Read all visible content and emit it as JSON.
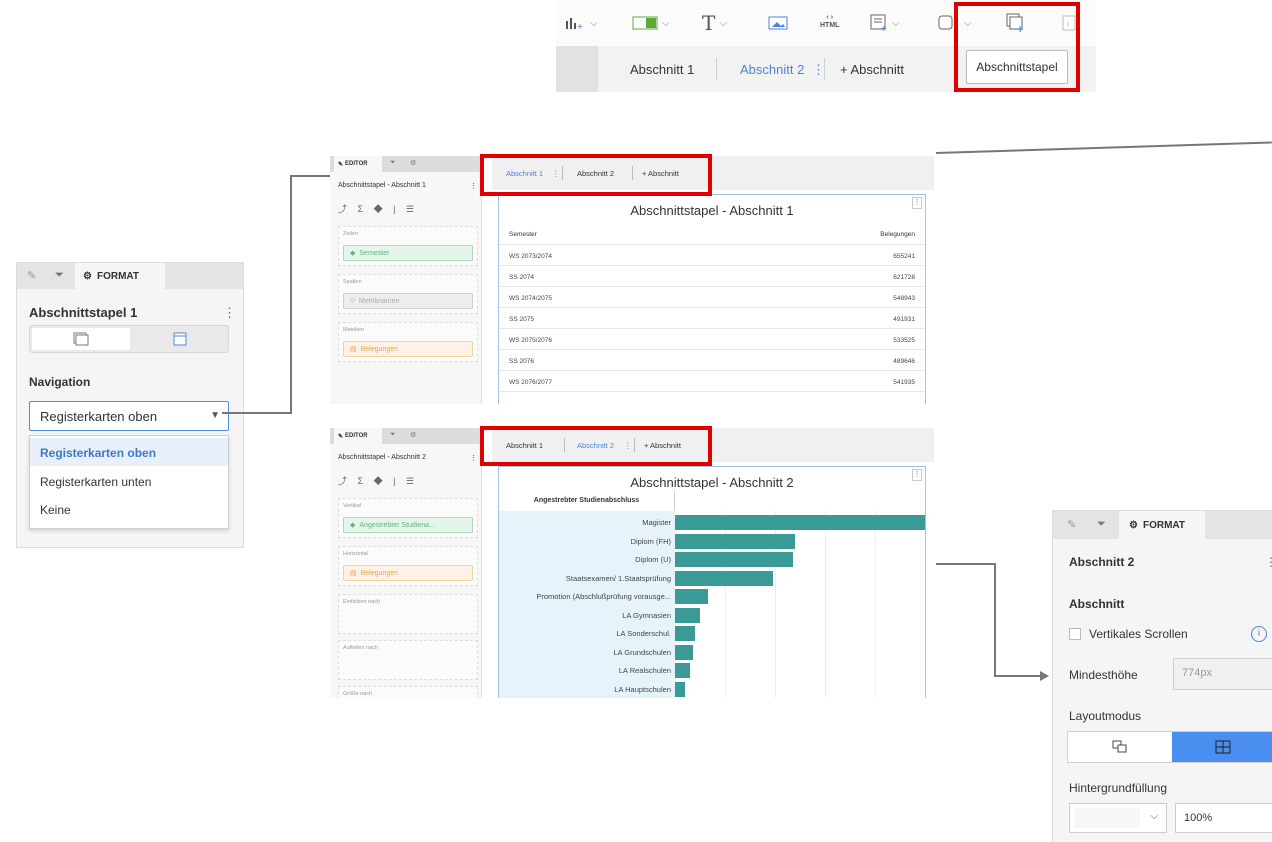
{
  "toolbar": {
    "items": [
      {
        "name": "chart-add-icon",
        "glyph": "ılıl₊"
      },
      {
        "name": "filter-control-icon",
        "glyph": "▭"
      },
      {
        "name": "text-icon",
        "glyph": "T"
      },
      {
        "name": "image-icon",
        "glyph": "▣"
      },
      {
        "name": "html-icon",
        "glyph": "HTML"
      },
      {
        "name": "panel-add-icon",
        "glyph": "▤₊"
      },
      {
        "name": "shape-icon",
        "glyph": "◻"
      },
      {
        "name": "section-stack-icon",
        "glyph": "⧉"
      }
    ],
    "section_tabs": [
      "Abschnitt 1",
      "Abschnitt 2",
      "+ Abschnitt"
    ],
    "tooltip": "Abschnittstapel"
  },
  "format_panel_left": {
    "tab_label": "FORMAT",
    "title": "Abschnittstapel 1",
    "kebab": "⋮",
    "navigation_label": "Navigation",
    "dropdown_value": "Registerkarten oben",
    "options": [
      "Registerkarten oben",
      "Registerkarten unten",
      "Keine"
    ]
  },
  "editor1": {
    "tab_label": "EDITOR",
    "title": "Abschnittstapel - Abschnitt 1",
    "tools": "⤴ Σ ◆ | ☰",
    "wells": [
      {
        "label": "Zeilen",
        "pill": "Semester",
        "style": "green"
      },
      {
        "label": "Spalten",
        "pill": "Metriknamen",
        "style": "gray"
      },
      {
        "label": "Metriken",
        "pill": "Belegungen",
        "style": "orange"
      }
    ]
  },
  "viz1": {
    "tabs": [
      "Abschnitt 1",
      "Abschnitt 2",
      "+ Abschnitt"
    ],
    "title": "Abschnittstapel - Abschnitt 1",
    "col1": "Semester",
    "col2": "Belegungen",
    "rows": [
      [
        "WS 2073/2074",
        "655241"
      ],
      [
        "SS 2074",
        "621728"
      ],
      [
        "WS 2074/2075",
        "548943"
      ],
      [
        "SS 2075",
        "491931"
      ],
      [
        "WS 2075/2076",
        "533525"
      ],
      [
        "SS 2076",
        "489646"
      ],
      [
        "WS 2076/2077",
        "541935"
      ]
    ]
  },
  "editor2": {
    "tab_label": "EDITOR",
    "title": "Abschnittstapel - Abschnitt 2",
    "tools": "⤴ Σ ◆ | ☰",
    "wells": [
      {
        "label": "Vertikal",
        "pill": "Angestrebter Studiena...",
        "style": "green"
      },
      {
        "label": "Horizontal",
        "pill": "Belegungen",
        "style": "orange"
      },
      {
        "label": "Einfärben nach",
        "pill": "",
        "style": ""
      },
      {
        "label": "Aufteilen nach",
        "pill": "",
        "style": ""
      },
      {
        "label": "Größe nach",
        "pill": "",
        "style": ""
      }
    ]
  },
  "viz2": {
    "tabs": [
      "Abschnitt 1",
      "Abschnitt 2",
      "+ Abschnitt"
    ],
    "title": "Abschnittstapel - Abschnitt 2",
    "header": "Angestrebter Studienabschluss"
  },
  "chart_data": {
    "type": "bar",
    "orientation": "horizontal",
    "categories": [
      "Magister",
      "Diplom (FH)",
      "Diplom (U)",
      "Staatsexamen/ 1.Staatsprüfung",
      "Promotion (Abschlußprüfung vorausge...",
      "LA Gymnasien",
      "LA Sonderschul.",
      "LA Grundschulen",
      "LA Realschulen",
      "LA Hauptschulen"
    ],
    "values": [
      100,
      48,
      47,
      39,
      13,
      10,
      8,
      7,
      6,
      4
    ],
    "color": "#3a9a96",
    "grid": true
  },
  "format_panel_right": {
    "tab_label": "FORMAT",
    "title": "Abschnitt 2",
    "kebab": "⋮",
    "section_label": "Abschnitt",
    "scroll_label": "Vertikales Scrollen",
    "min_height_label": "Mindesthöhe",
    "min_height_value": "774px",
    "layout_label": "Layoutmodus",
    "bg_label": "Hintergrundfüllung",
    "opacity": "100%"
  },
  "colors": {
    "highlight": "#e00000",
    "accent": "#4a86d8",
    "bar": "#3a9a96"
  }
}
